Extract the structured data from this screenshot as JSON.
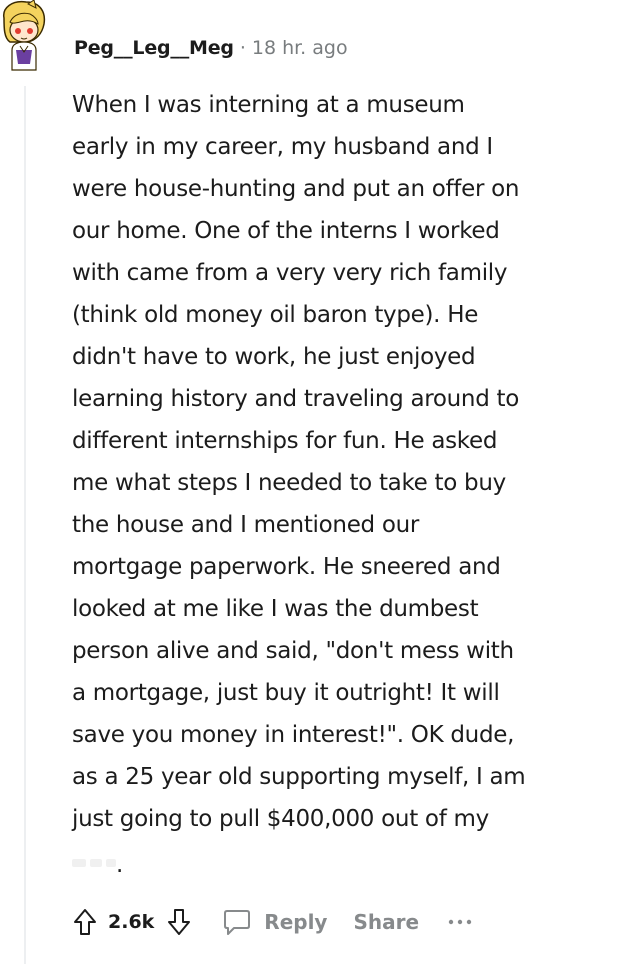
{
  "comment": {
    "username": "Peg__Leg__Meg",
    "separator": "·",
    "time_ago": "18 hr. ago",
    "body_lines": [
      "When I was interning at a museum",
      "early in my career, my husband and I",
      "were house-hunting and put an offer on",
      "our home. One of the interns I worked",
      "with came from a very very rich family",
      "(think old money oil baron type). He",
      "didn't have to work, he just enjoyed",
      "learning history and traveling around to",
      "different internships for fun. He asked",
      "me what steps I needed to take to buy",
      "the house and I mentioned our",
      "mortgage paperwork. He sneered and",
      "looked at me like I was the dumbest",
      "person alive and said, \"don't mess with",
      "a mortgage, just buy it outright! It will",
      "save you money in interest!\". OK dude,",
      "as a 25 year old supporting myself, I am",
      "just going to pull $400,000 out of my"
    ],
    "redacted_end": "."
  },
  "actions": {
    "vote_count": "2.6k",
    "reply_label": "Reply",
    "share_label": "Share"
  },
  "icons": {
    "avatar": "avatar-icon",
    "upvote": "upvote-arrow-icon",
    "downvote": "downvote-arrow-icon",
    "reply": "comment-bubble-icon",
    "more": "more-options-icon"
  },
  "colors": {
    "text": "#1c1c1c",
    "meta": "#787c7e",
    "action": "#878a8c",
    "thread_line": "#edeff1"
  }
}
